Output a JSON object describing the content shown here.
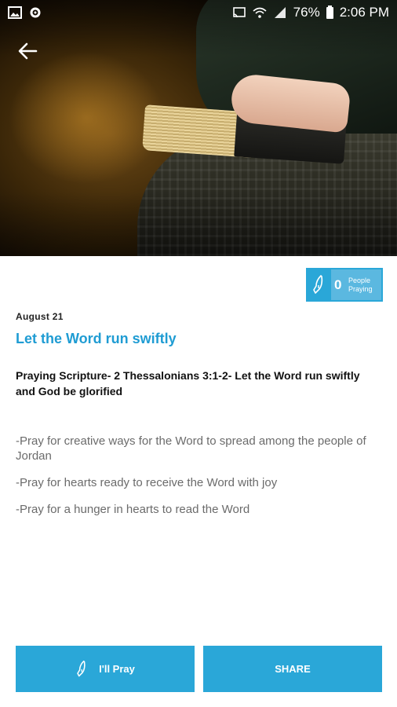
{
  "status_bar": {
    "battery": "76%",
    "time": "2:06 PM"
  },
  "badge": {
    "count": "0",
    "label_line1": "People",
    "label_line2": "Praying"
  },
  "prayer": {
    "date": "August 21",
    "title": "Let the Word run swiftly",
    "scripture": "Praying Scripture- 2 Thessalonians 3:1-2- Let the Word run swiftly and God be glorified",
    "points": [
      "-Pray for creative ways for the Word to spread among the people of Jordan",
      "-Pray for hearts ready to receive the Word with joy",
      "-Pray for a hunger in hearts to read the Word"
    ]
  },
  "actions": {
    "pray_label": "I'll Pray",
    "share_label": "SHARE"
  },
  "colors": {
    "accent": "#2aa7d8",
    "title": "#1f9cd3"
  },
  "icons": {
    "back": "arrow-left-icon",
    "pray": "praying-hands-icon"
  }
}
